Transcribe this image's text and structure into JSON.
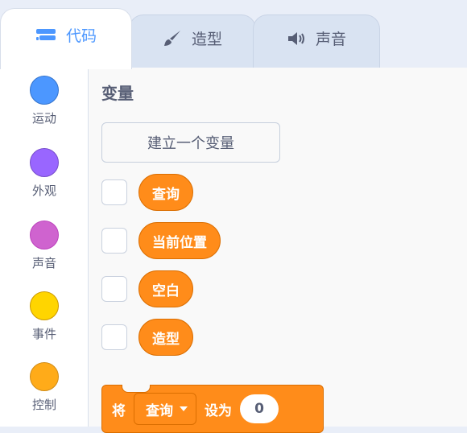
{
  "tabs": [
    {
      "label": "代码",
      "icon": "code-blocks-icon",
      "active": true
    },
    {
      "label": "造型",
      "icon": "paintbrush-icon",
      "active": false
    },
    {
      "label": "声音",
      "icon": "speaker-icon",
      "active": false
    }
  ],
  "categories": [
    {
      "label": "运动",
      "color": "#4c97ff"
    },
    {
      "label": "外观",
      "color": "#9966ff"
    },
    {
      "label": "声音",
      "color": "#cf63cf"
    },
    {
      "label": "事件",
      "color": "#ffd500"
    },
    {
      "label": "控制",
      "color": "#ffab19"
    }
  ],
  "palette": {
    "section_title": "变量",
    "make_variable_label": "建立一个变量",
    "variables": [
      "查询",
      "当前位置",
      "空白",
      "造型"
    ],
    "set_block": {
      "prefix": "将",
      "selected_variable": "查询",
      "middle": "设为",
      "value": "0"
    }
  },
  "colors": {
    "variables_block": "#ff8c1a",
    "active_tab_text": "#4c97ff"
  }
}
